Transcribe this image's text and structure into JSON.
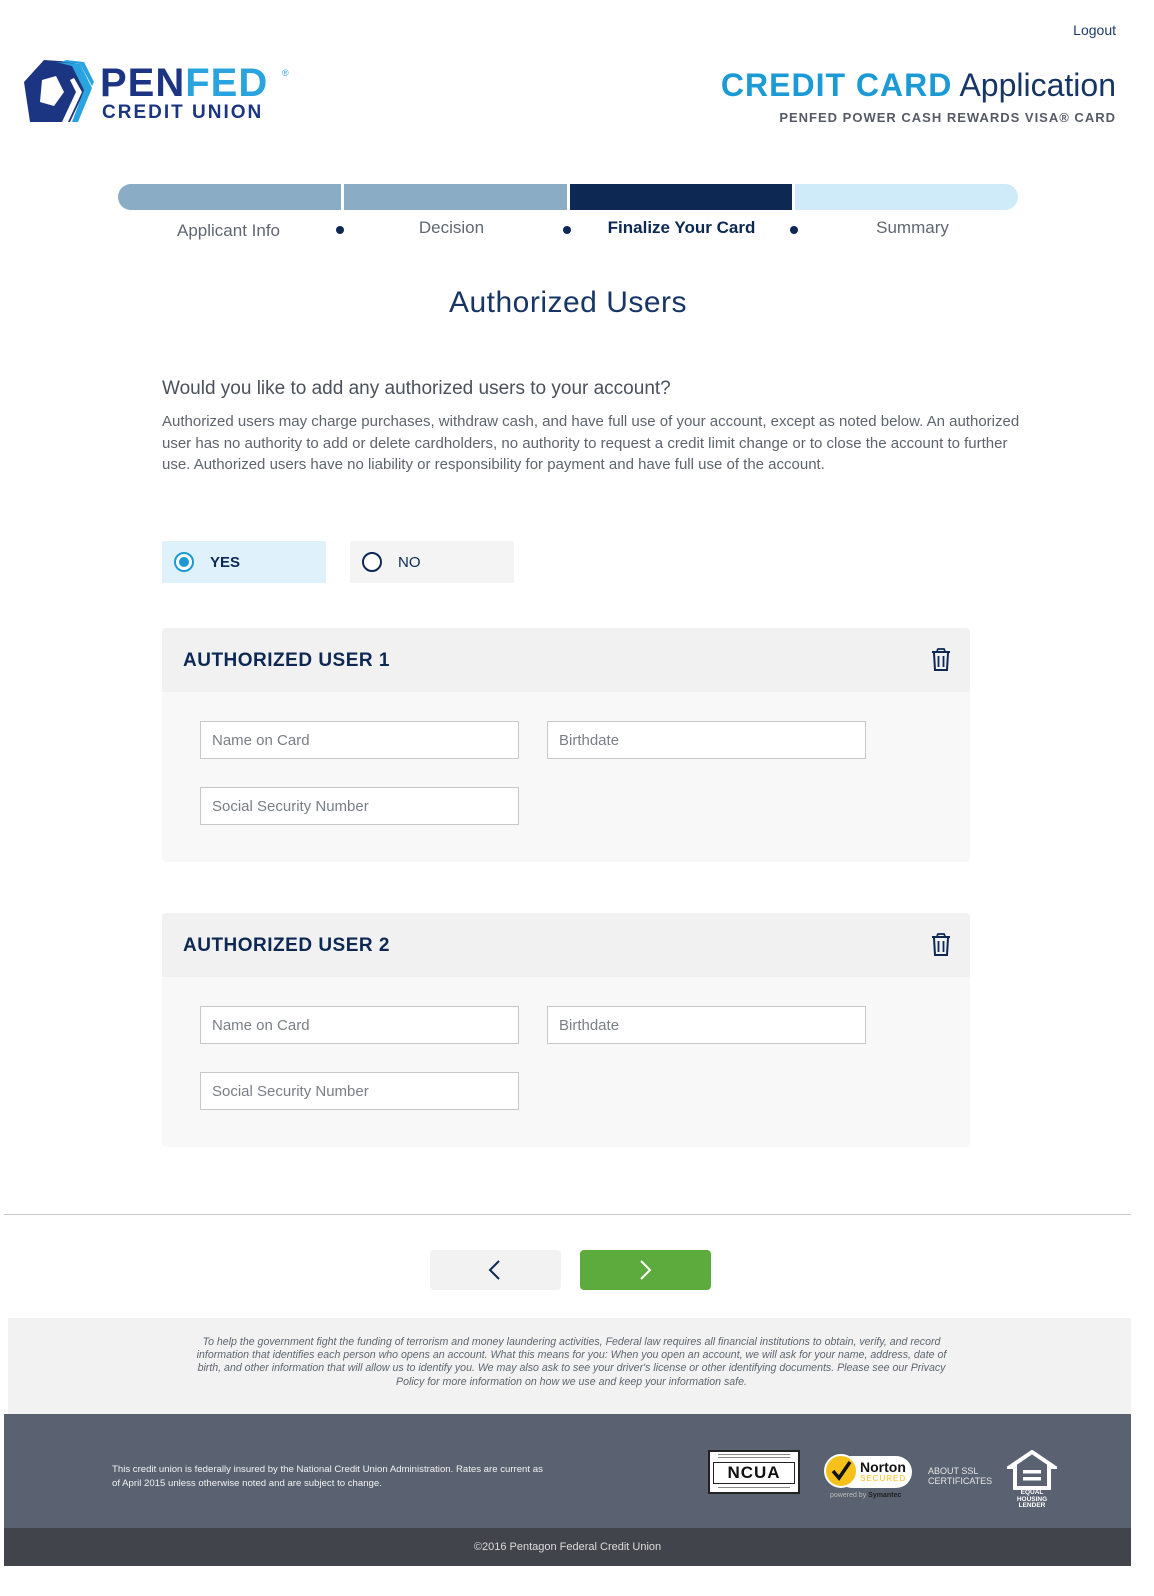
{
  "header": {
    "logout_label": "Logout",
    "logo": {
      "word1": "PEN",
      "word2": "FED",
      "subtitle": "CREDIT UNION",
      "reg": "®"
    },
    "title_bold": "CREDIT CARD",
    "title_light": "Application",
    "card_name": "PENFED POWER CASH REWARDS VISA® CARD"
  },
  "progress": {
    "steps": [
      {
        "label": "Applicant Info",
        "state": "complete"
      },
      {
        "label": "Decision",
        "state": "complete"
      },
      {
        "label": "Finalize Your Card",
        "state": "active"
      },
      {
        "label": "Summary",
        "state": "upcoming"
      }
    ]
  },
  "main": {
    "page_title": "Authorized Users",
    "question": "Would you like to add any authorized users to your account?",
    "description": "Authorized users may charge purchases, withdraw cash, and have full use of your account, except as noted below. An authorized user has no authority to add or delete cardholders, no authority to request a credit limit change or to close the account to further use. Authorized users have no liability or responsibility for payment and have full use of the account.",
    "options": {
      "yes_label": "YES",
      "no_label": "NO",
      "selected": "YES"
    },
    "users": [
      {
        "title": "AUTHORIZED USER 1",
        "name_placeholder": "Name on Card",
        "birthdate_placeholder": "Birthdate",
        "ssn_placeholder": "Social Security Number"
      },
      {
        "title": "AUTHORIZED USER 2",
        "name_placeholder": "Name on Card",
        "birthdate_placeholder": "Birthdate",
        "ssn_placeholder": "Social Security Number"
      }
    ]
  },
  "legal_notice": "To help the government fight the funding of terrorism and money laundering activities, Federal law requires all financial institutions to obtain, verify, and record information that identifies each person who opens an account. What this means for you: When you open an account, we will ask for your name, address, date of birth, and other information that will allow us to identify you. We may also ask to see your driver's license or other identifying documents. Please see our Privacy Policy for more information on how we use and keep your information safe.",
  "footer": {
    "insurance_text": "This credit union is federally insured by the National Credit Union Administration. Rates are current as of April 2015 unless otherwise noted and are subject to change.",
    "ncua_label": "NCUA",
    "norton_name": "Norton",
    "norton_secured": "SECURED",
    "norton_powered": "powered by",
    "norton_symantec": "Symantec",
    "ssl_line1": "ABOUT SSL",
    "ssl_line2": "CERTIFICATES",
    "ehl_line1": "EQUAL HOUSING",
    "ehl_line2": "LENDER",
    "copyright": "©2016 Pentagon Federal Credit Union"
  },
  "colors": {
    "brand_navy": "#0c2853",
    "brand_blue": "#1b9ad6",
    "progress_done": "#8aacc4",
    "progress_todo": "#cfeaf8",
    "next_green": "#5cab3c",
    "footer_gray": "#5a6170"
  }
}
